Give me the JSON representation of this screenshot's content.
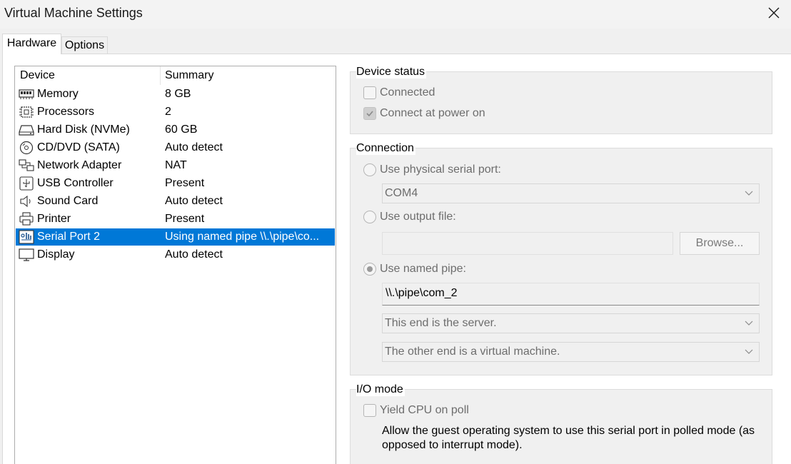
{
  "window": {
    "title": "Virtual Machine Settings"
  },
  "tabs": [
    {
      "label": "Hardware",
      "active": true
    },
    {
      "label": "Options",
      "active": false
    }
  ],
  "device_list": {
    "headers": {
      "device": "Device",
      "summary": "Summary"
    },
    "rows": [
      {
        "name": "Memory",
        "summary": "8 GB",
        "icon": "memory-icon"
      },
      {
        "name": "Processors",
        "summary": "2",
        "icon": "processor-icon"
      },
      {
        "name": "Hard Disk (NVMe)",
        "summary": "60 GB",
        "icon": "hard-disk-icon"
      },
      {
        "name": "CD/DVD (SATA)",
        "summary": "Auto detect",
        "icon": "cd-dvd-icon"
      },
      {
        "name": "Network Adapter",
        "summary": "NAT",
        "icon": "network-adapter-icon"
      },
      {
        "name": "USB Controller",
        "summary": "Present",
        "icon": "usb-icon"
      },
      {
        "name": "Sound Card",
        "summary": "Auto detect",
        "icon": "speaker-icon"
      },
      {
        "name": "Printer",
        "summary": "Present",
        "icon": "printer-icon"
      },
      {
        "name": "Serial Port 2",
        "summary": "Using named pipe \\\\.\\pipe\\co...",
        "icon": "serial-port-icon",
        "selected": true
      },
      {
        "name": "Display",
        "summary": "Auto detect",
        "icon": "display-icon"
      }
    ]
  },
  "device_status": {
    "title": "Device status",
    "connected": {
      "label": "Connected",
      "checked": false
    },
    "connect_power_on": {
      "label": "Connect at power on",
      "checked": true
    }
  },
  "connection": {
    "title": "Connection",
    "physical": {
      "label": "Use physical serial port:",
      "value": "COM4"
    },
    "output_file": {
      "label": "Use output file:",
      "value": "",
      "browse_label": "Browse..."
    },
    "named_pipe": {
      "label": "Use named pipe:",
      "value": "\\\\.\\pipe\\com_2",
      "this_end": "This end is the server.",
      "other_end": "The other end is a virtual machine."
    }
  },
  "io_mode": {
    "title": "I/O mode",
    "yield": {
      "label": "Yield CPU on poll",
      "checked": false
    },
    "description": "Allow the guest operating system to use this serial port in polled mode (as opposed to interrupt mode)."
  }
}
